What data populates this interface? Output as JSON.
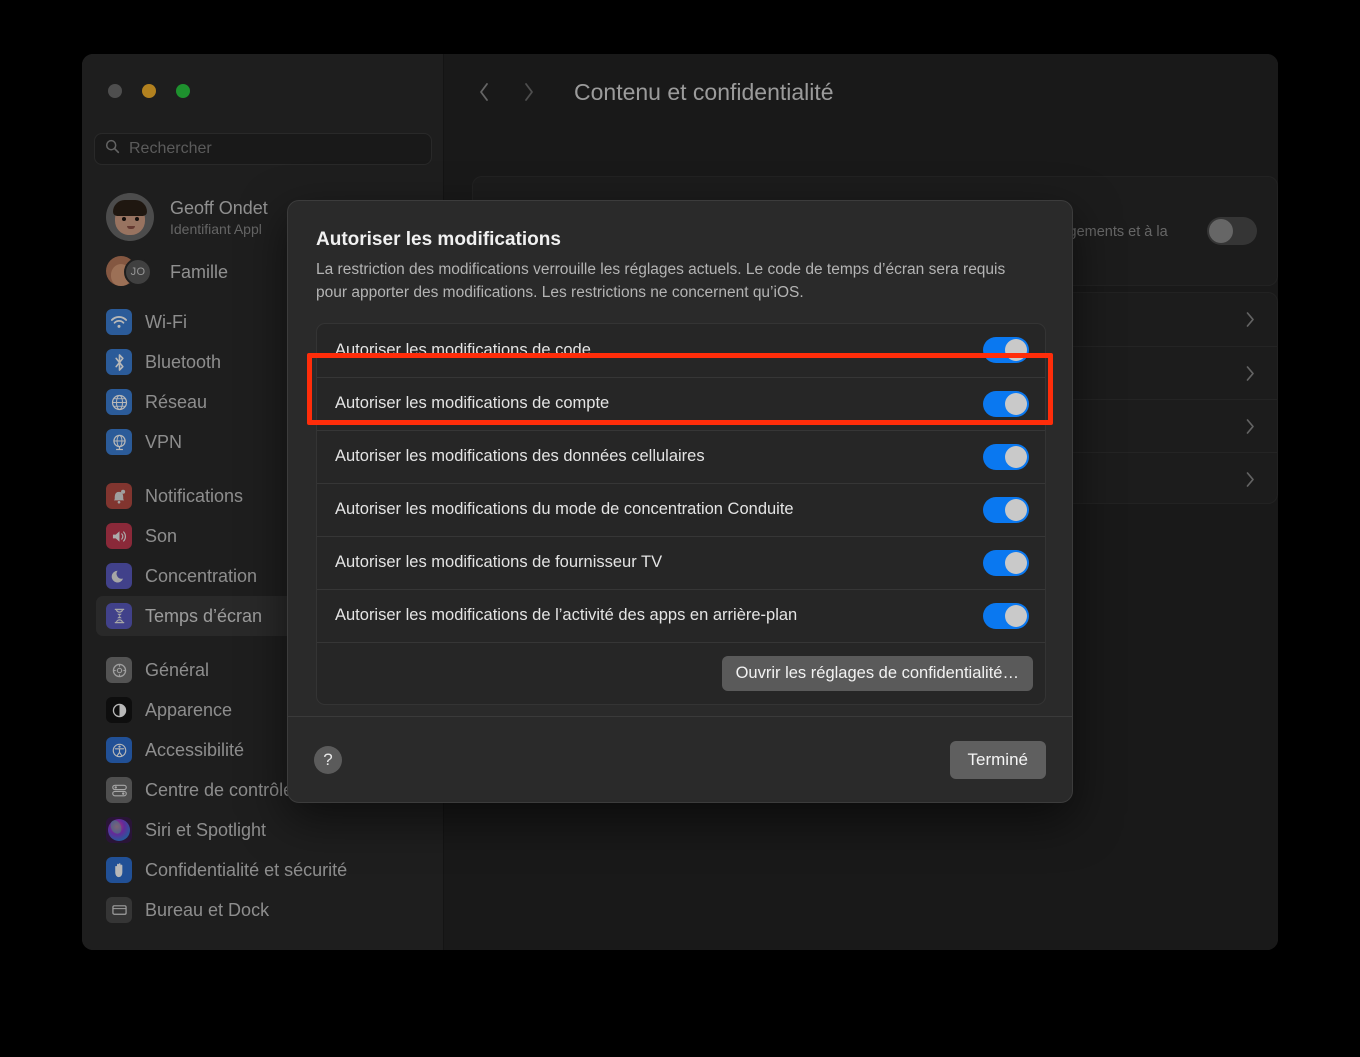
{
  "window": {
    "traffic_lights": [
      "close",
      "minimize",
      "zoom"
    ],
    "search": {
      "placeholder": "Rechercher",
      "value": "",
      "icon": "search-icon"
    },
    "account": {
      "name": "Geoff Ondet",
      "subtitle": "Identifiant Appl",
      "avatar": "memoji-avatar"
    },
    "family": {
      "label": "Famille",
      "badge": "JO"
    },
    "nav_groups": [
      {
        "items": [
          {
            "label": "Wi-Fi",
            "icon": "wifi-icon",
            "color": "#3c7fd4",
            "selected": false
          },
          {
            "label": "Bluetooth",
            "icon": "bluetooth-icon",
            "color": "#3c7fd4",
            "selected": false
          },
          {
            "label": "Réseau",
            "icon": "globe-icon",
            "color": "#3c7fd4",
            "selected": false
          },
          {
            "label": "VPN",
            "icon": "vpn-globe-icon",
            "color": "#3c7fd4",
            "selected": false
          }
        ]
      },
      {
        "items": [
          {
            "label": "Notifications",
            "icon": "bell-icon",
            "color": "#b34a42",
            "selected": false
          },
          {
            "label": "Son",
            "icon": "speaker-icon",
            "color": "#c0394f",
            "selected": false
          },
          {
            "label": "Concentration",
            "icon": "moon-icon",
            "color": "#5b5bbf",
            "selected": false
          },
          {
            "label": "Temps d’écran",
            "icon": "hourglass-icon",
            "color": "#5b5bbf",
            "selected": true
          }
        ]
      },
      {
        "items": [
          {
            "label": "Général",
            "icon": "gear-icon",
            "color": "#737373",
            "selected": false
          },
          {
            "label": "Apparence",
            "icon": "appearance-icon",
            "color": "#141414",
            "selected": false
          },
          {
            "label": "Accessibilité",
            "icon": "accessibility-icon",
            "color": "#2e6fd0",
            "selected": false
          },
          {
            "label": "Centre de contrôle",
            "icon": "control-center-icon",
            "color": "#6e6e6e",
            "selected": false
          },
          {
            "label": "Siri et Spotlight",
            "icon": "siri-icon",
            "color": "#55307a",
            "selected": false
          },
          {
            "label": "Confidentialité et sécurité",
            "icon": "hand-icon",
            "color": "#2e6fd0",
            "selected": false
          },
          {
            "label": "Bureau et Dock",
            "icon": "desktop-dock-icon",
            "color": "#4a4a4a",
            "selected": false
          }
        ]
      }
    ]
  },
  "main": {
    "back_icon": "chevron-left-icon",
    "forward_icon": "chevron-right-icon",
    "title": "Contenu et confidentialité",
    "content_privacy": {
      "icon": "prohibited-icon",
      "title": "Contenu et confidentialité",
      "description": "Limitez l’accès aux réglages relatifs au contenu explicite, aux achats, aux téléchargements et à la confidentialité.",
      "toggle_state": "off"
    },
    "detail_rows": [
      {
        "chevron": "chevron-right-icon"
      },
      {
        "chevron": "chevron-right-icon"
      },
      {
        "chevron": "chevron-right-icon"
      },
      {
        "chevron": "chevron-right-icon"
      }
    ],
    "help_button": "?"
  },
  "dialog": {
    "title": "Autoriser les modifications",
    "description": "La restriction des modifications verrouille les réglages actuels. Le code de temps d’écran sera requis pour apporter des modifications. Les restrictions ne concernent qu’iOS.",
    "toggles": [
      {
        "label": "Autoriser les modifications de code",
        "state": "on"
      },
      {
        "label": "Autoriser les modifications de compte",
        "state": "on",
        "highlighted": true
      },
      {
        "label": "Autoriser les modifications des données cellulaires",
        "state": "on"
      },
      {
        "label": "Autoriser les modifications du mode de concentration Conduite",
        "state": "on"
      },
      {
        "label": "Autoriser les modifications de fournisseur TV",
        "state": "on"
      },
      {
        "label": "Autoriser les modifications de l’activité des apps en arrière-plan",
        "state": "on"
      }
    ],
    "open_privacy_button": "Ouvrir les réglages de confidentialité…",
    "help_button": "?",
    "done_button": "Terminé"
  },
  "colors": {
    "accent_toggle_on": "#0a78f0",
    "highlight_box": "#ff2d0a",
    "window_bg": "#232323",
    "sidebar_bg": "#2a2a2a"
  }
}
